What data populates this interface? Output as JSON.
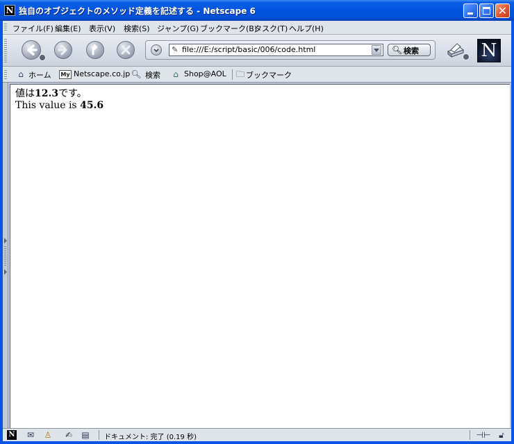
{
  "window": {
    "title": "独自のオブジェクトのメソッド定義を記述する - Netscape 6"
  },
  "menu": {
    "items": [
      "ファイル(F)",
      "編集(E)",
      "表示(V)",
      "検索(S)",
      "ジャンプ(G)",
      "ブックマーク(B)",
      "タスク(T)",
      "ヘルプ(H)"
    ]
  },
  "navbar": {
    "url": "file:///E:/script/basic/006/code.html",
    "search_label": "検索"
  },
  "personal_toolbar": {
    "items": [
      "ホーム",
      "Netscape.co.jp",
      "検索",
      "Shop@AOL",
      "ブックマーク"
    ],
    "my_badge": "My"
  },
  "page": {
    "line1_prefix": "値は",
    "line1_value": "12.3",
    "line1_suffix": "です。",
    "line2_prefix": "This value is ",
    "line2_value": "45.6"
  },
  "statusbar": {
    "text": "ドキュメント: 完了 (0.19 秒)"
  },
  "icons": {
    "app": "netscape-n-icon",
    "back": "back-arrow-icon",
    "forward": "forward-arrow-icon",
    "reload": "reload-icon",
    "stop": "stop-icon",
    "print": "print-icon",
    "home": "home-icon",
    "search": "magnifier-icon",
    "shop": "shop-icon",
    "bookmark": "folder-icon"
  }
}
